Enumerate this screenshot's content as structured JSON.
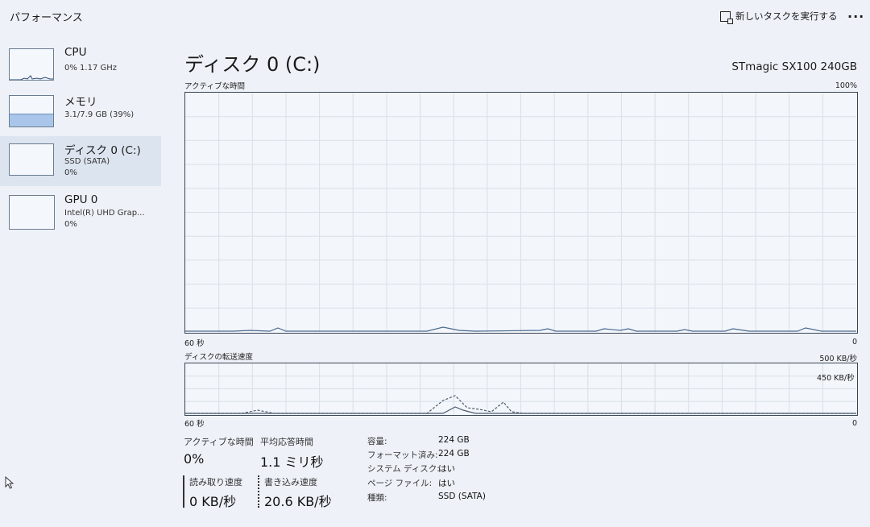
{
  "header": {
    "title": "パフォーマンス",
    "new_task": "新しいタスクを実行する",
    "more": "..."
  },
  "sidebar": {
    "items": [
      {
        "name": "CPU",
        "line1": "0% 1.17 GHz",
        "line2": ""
      },
      {
        "name": "メモリ",
        "line1": "3.1/7.9 GB (39%)",
        "line2": "",
        "fill_percent": 39
      },
      {
        "name": "ディスク 0 (C:)",
        "line1": "SSD (SATA)",
        "line2": "0%"
      },
      {
        "name": "GPU 0",
        "line1": "Intel(R) UHD Grap...",
        "line2": "0%"
      }
    ]
  },
  "main": {
    "title": "ディスク 0 (C:)",
    "model": "STmagic SX100 240GB",
    "active_graph": {
      "label": "アクティブな時間",
      "max": "100%",
      "time": "60 秒",
      "min": "0"
    },
    "transfer_graph": {
      "label": "ディスクの転送速度",
      "max": "500 KB/秒",
      "inner": "450 KB/秒",
      "time": "60 秒",
      "min": "0"
    },
    "stats": {
      "active_time_label": "アクティブな時間",
      "active_time_value": "0%",
      "avg_response_label": "平均応答時間",
      "avg_response_value": "1.1 ミリ秒",
      "read_label": "読み取り速度",
      "read_value": "0 KB/秒",
      "write_label": "書き込み速度",
      "write_value": "20.6 KB/秒"
    },
    "properties": [
      {
        "label": "容量:",
        "value": "224 GB"
      },
      {
        "label": "フォーマット済み:",
        "value": "224 GB"
      },
      {
        "label": "システム ディスク:",
        "value": "はい"
      },
      {
        "label": "ページ ファイル:",
        "value": "はい"
      },
      {
        "label": "種類:",
        "value": "SSD (SATA)"
      }
    ]
  }
}
